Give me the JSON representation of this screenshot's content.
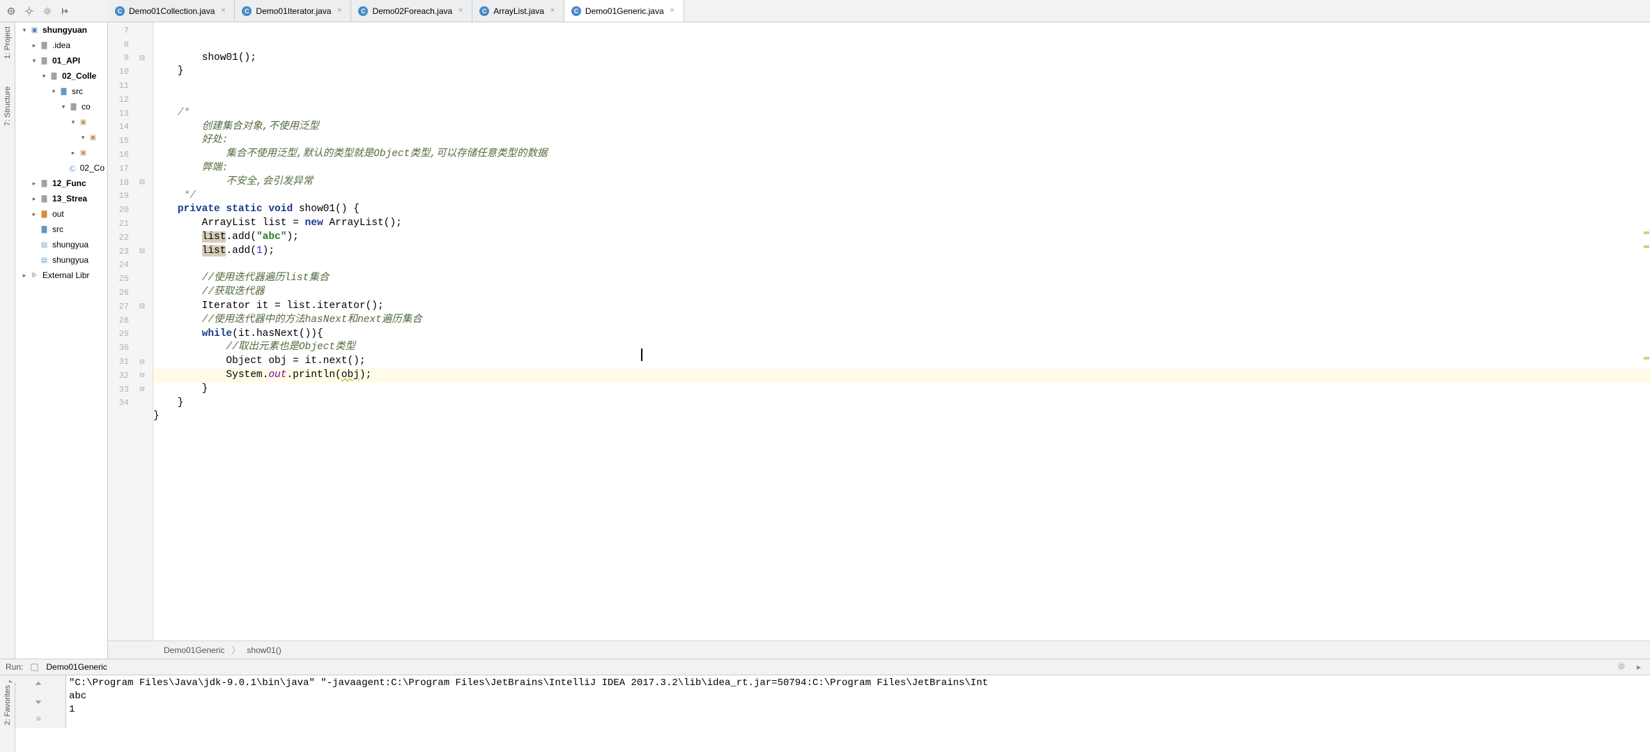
{
  "sidebar_labels": {
    "project": "1: Project",
    "structure": "7: Structure",
    "favorites": "2: Favorites"
  },
  "tabs": [
    {
      "name": "Demo01Collection.java"
    },
    {
      "name": "Demo01Iterator.java"
    },
    {
      "name": "Demo02Foreach.java"
    },
    {
      "name": "ArrayList.java"
    },
    {
      "name": "Demo01Generic.java",
      "active": true
    }
  ],
  "tree": [
    {
      "indent": 0,
      "arrow": "▾",
      "icon": "module",
      "label": "shungyuan",
      "bold": true
    },
    {
      "indent": 1,
      "arrow": "▸",
      "icon": "folder",
      "label": ".idea"
    },
    {
      "indent": 1,
      "arrow": "▾",
      "icon": "folder",
      "label": "01_API",
      "bold": true
    },
    {
      "indent": 2,
      "arrow": "▾",
      "icon": "folder",
      "label": "02_Colle",
      "bold": true
    },
    {
      "indent": 3,
      "arrow": "▾",
      "icon": "folder-blue",
      "label": "src"
    },
    {
      "indent": 4,
      "arrow": "▾",
      "icon": "folder",
      "label": "co"
    },
    {
      "indent": 5,
      "arrow": "▾",
      "icon": "pkg",
      "label": ""
    },
    {
      "indent": 6,
      "arrow": "▾",
      "icon": "pkg",
      "label": ""
    },
    {
      "indent": 5,
      "arrow": "▸",
      "icon": "pkg",
      "label": ""
    },
    {
      "indent": 4,
      "arrow": "",
      "icon": "class",
      "label": "02_Co"
    },
    {
      "indent": 1,
      "arrow": "▸",
      "icon": "folder",
      "label": "12_Func",
      "bold": true
    },
    {
      "indent": 1,
      "arrow": "▸",
      "icon": "folder",
      "label": "13_Strea",
      "bold": true
    },
    {
      "indent": 1,
      "arrow": "▸",
      "icon": "folder-orange",
      "label": "out"
    },
    {
      "indent": 1,
      "arrow": "",
      "icon": "folder-blue",
      "label": "src"
    },
    {
      "indent": 1,
      "arrow": "",
      "icon": "iml",
      "label": "shungyua"
    },
    {
      "indent": 1,
      "arrow": "",
      "icon": "iml",
      "label": "shungyua"
    },
    {
      "indent": 0,
      "arrow": "▸",
      "icon": "lib",
      "label": "External Libr"
    }
  ],
  "gutter_start": 7,
  "gutter_end": 34,
  "fold_rows": [
    9,
    18,
    23,
    27
  ],
  "close_rows": [
    31,
    32,
    33
  ],
  "code_lines": [
    {
      "n": 7,
      "html": "        show01();"
    },
    {
      "n": 8,
      "html": "    }"
    },
    {
      "n": 9,
      "html": ""
    },
    {
      "n": 10,
      "html": ""
    },
    {
      "n": 11,
      "html": "    <span class='com'>/*</span>"
    },
    {
      "n": 12,
      "html": "        <span class='com-cn'>创建集合对象,不使用泛型</span>"
    },
    {
      "n": 13,
      "html": "        <span class='com-cn'>好处:</span>"
    },
    {
      "n": 14,
      "html": "            <span class='com-cn'>集合不使用泛型,默认的类型就是</span><span class='com-it'>Object</span><span class='com-cn'>类型,可以存储任意类型的数据</span>"
    },
    {
      "n": 15,
      "html": "        <span class='com-cn'>弊端:</span>"
    },
    {
      "n": 16,
      "html": "            <span class='com-cn'>不安全,会引发异常</span>"
    },
    {
      "n": 17,
      "html": "     <span class='com'>*/</span>"
    },
    {
      "n": 18,
      "html": "    <span class='kw'>private static void</span> show01() {"
    },
    {
      "n": 19,
      "html": "        ArrayList list = <span class='kw'>new</span> ArrayList();"
    },
    {
      "n": 20,
      "html": "        <span class='sel-bg'>list</span>.add(<span class='str'>\"abc\"</span>);"
    },
    {
      "n": 21,
      "html": "        <span class='sel-bg'>list</span>.add(<span class='num'>1</span>);"
    },
    {
      "n": 22,
      "html": ""
    },
    {
      "n": 23,
      "html": "        <span class='com-cn'>//使用迭代器遍历</span><span class='com-it'>list</span><span class='com-cn'>集合</span>"
    },
    {
      "n": 24,
      "html": "        <span class='com-cn'>//获取迭代器</span>"
    },
    {
      "n": 25,
      "html": "        Iterator it = list.iterator();"
    },
    {
      "n": 26,
      "html": "        <span class='com-cn'>//使用迭代器中的方法</span><span class='com-it'>hasNext</span><span class='com-cn'>和</span><span class='com-it'>next</span><span class='com-cn'>遍历集合</span>"
    },
    {
      "n": 27,
      "html": "        <span class='kw'>while</span>(it.hasNext()){"
    },
    {
      "n": 28,
      "html": "            <span class='com-cn'>//取出元素也是</span><span class='com-it'>Object</span><span class='com-cn'>类型</span>"
    },
    {
      "n": 29,
      "html": "            Object obj = it.next();"
    },
    {
      "n": 30,
      "html": "            System.<span class='field-it'>out</span>.println(<span class='warn-underline'>obj</span>);",
      "highlight": true
    },
    {
      "n": 31,
      "html": "        }"
    },
    {
      "n": 32,
      "html": "    }"
    },
    {
      "n": 33,
      "html": "}"
    },
    {
      "n": 34,
      "html": ""
    }
  ],
  "breadcrumb": {
    "class": "Demo01Generic",
    "method": "show01()"
  },
  "run_header": {
    "label": "Run:",
    "config": "Demo01Generic"
  },
  "console": [
    "\"C:\\Program Files\\Java\\jdk-9.0.1\\bin\\java\" \"-javaagent:C:\\Program Files\\JetBrains\\IntelliJ IDEA 2017.3.2\\lib\\idea_rt.jar=50794:C:\\Program Files\\JetBrains\\Int",
    "abc",
    "1"
  ]
}
